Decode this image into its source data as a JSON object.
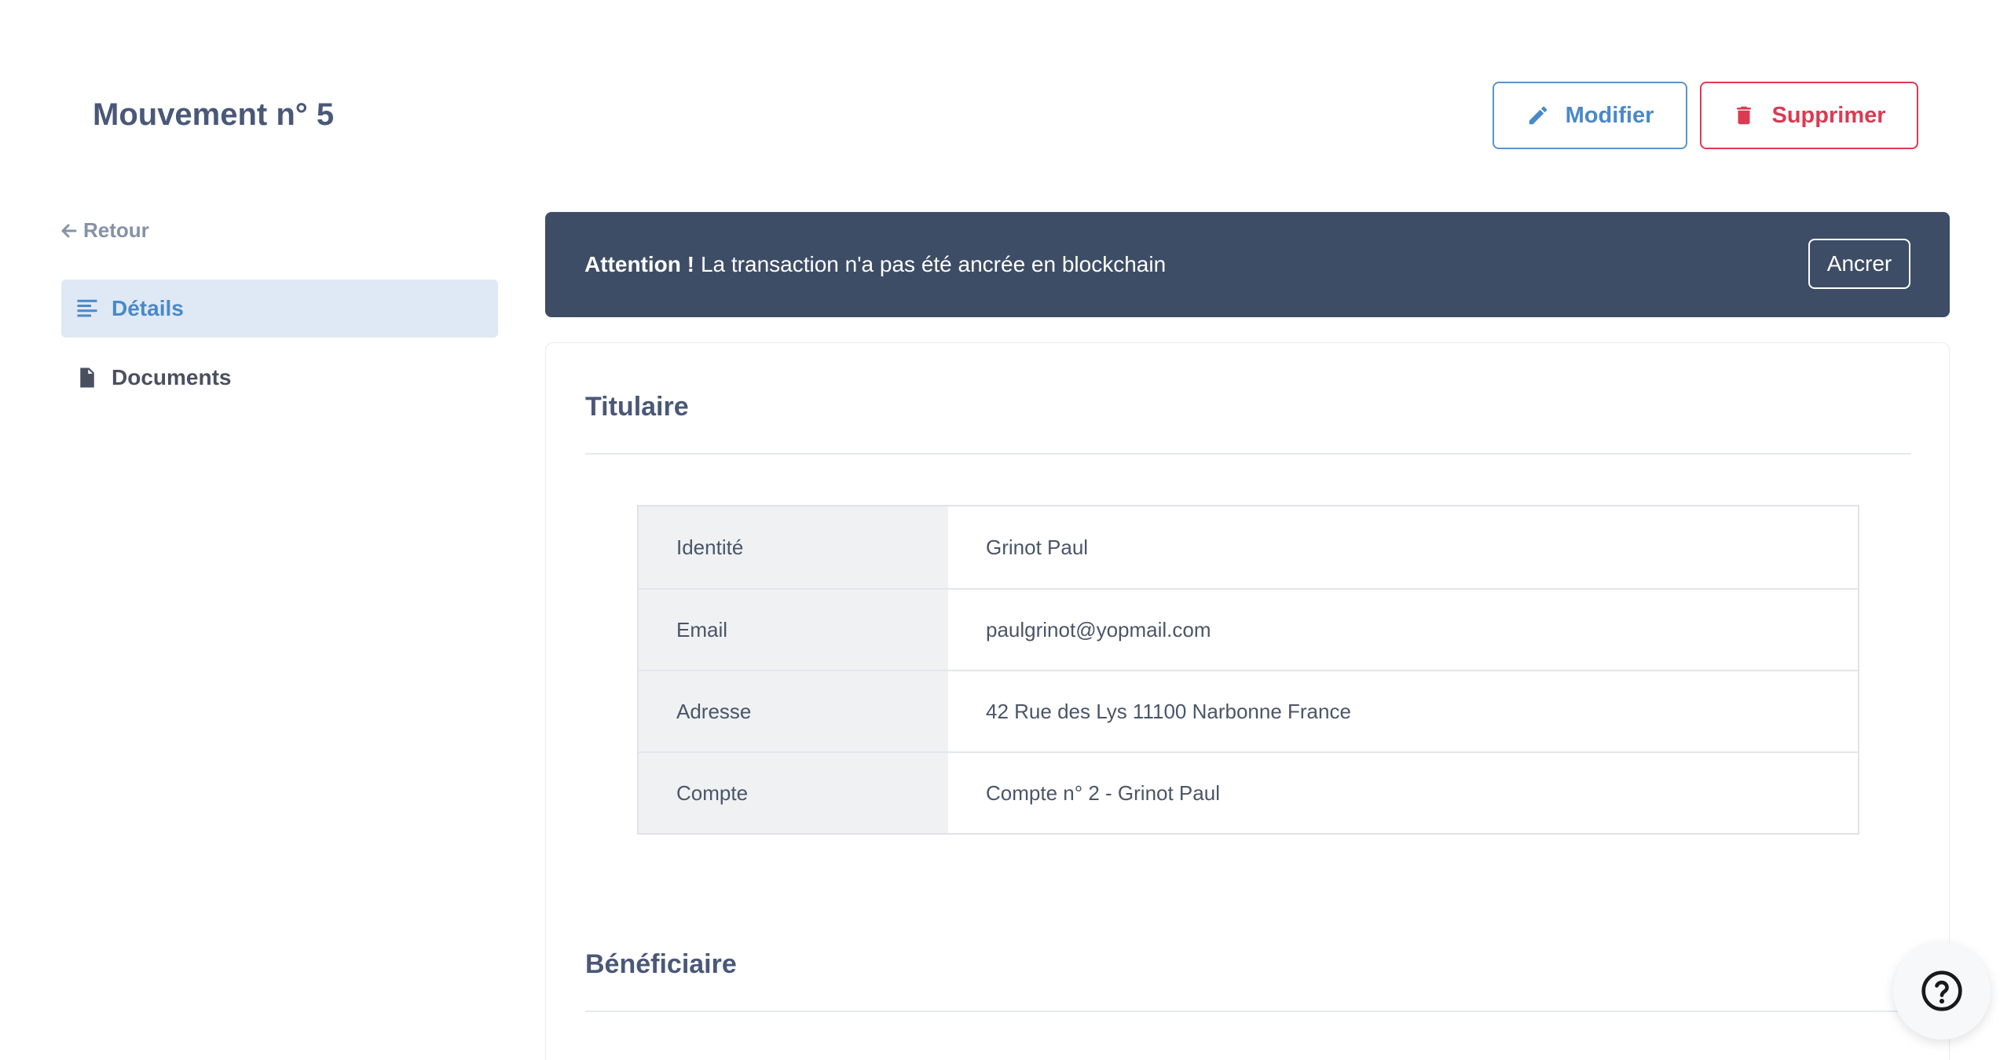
{
  "header": {
    "title": "Mouvement n° 5",
    "edit_label": "Modifier",
    "delete_label": "Supprimer"
  },
  "sidebar": {
    "back_label": "Retour",
    "items": [
      {
        "label": "Détails",
        "icon": "align-left-icon",
        "active": true
      },
      {
        "label": "Documents",
        "icon": "file-icon",
        "active": false
      }
    ]
  },
  "alert": {
    "strong": "Attention !",
    "message": "La transaction n'a pas été ancrée en blockchain",
    "button_label": "Ancrer"
  },
  "titulaire": {
    "title": "Titulaire",
    "rows": [
      {
        "label": "Identité",
        "value": "Grinot Paul"
      },
      {
        "label": "Email",
        "value": "paulgrinot@yopmail.com"
      },
      {
        "label": "Adresse",
        "value": "42 Rue des Lys 11100 Narbonne France"
      },
      {
        "label": "Compte",
        "value": "Compte n° 2 - Grinot Paul"
      }
    ]
  },
  "beneficiaire": {
    "title": "Bénéficiaire"
  },
  "colors": {
    "primary": "#4a89c8",
    "danger": "#dc3a52",
    "alert_bg": "#3e4d66",
    "active_bg": "#dfe9f5"
  },
  "help": {
    "icon": "question-circle-icon"
  }
}
